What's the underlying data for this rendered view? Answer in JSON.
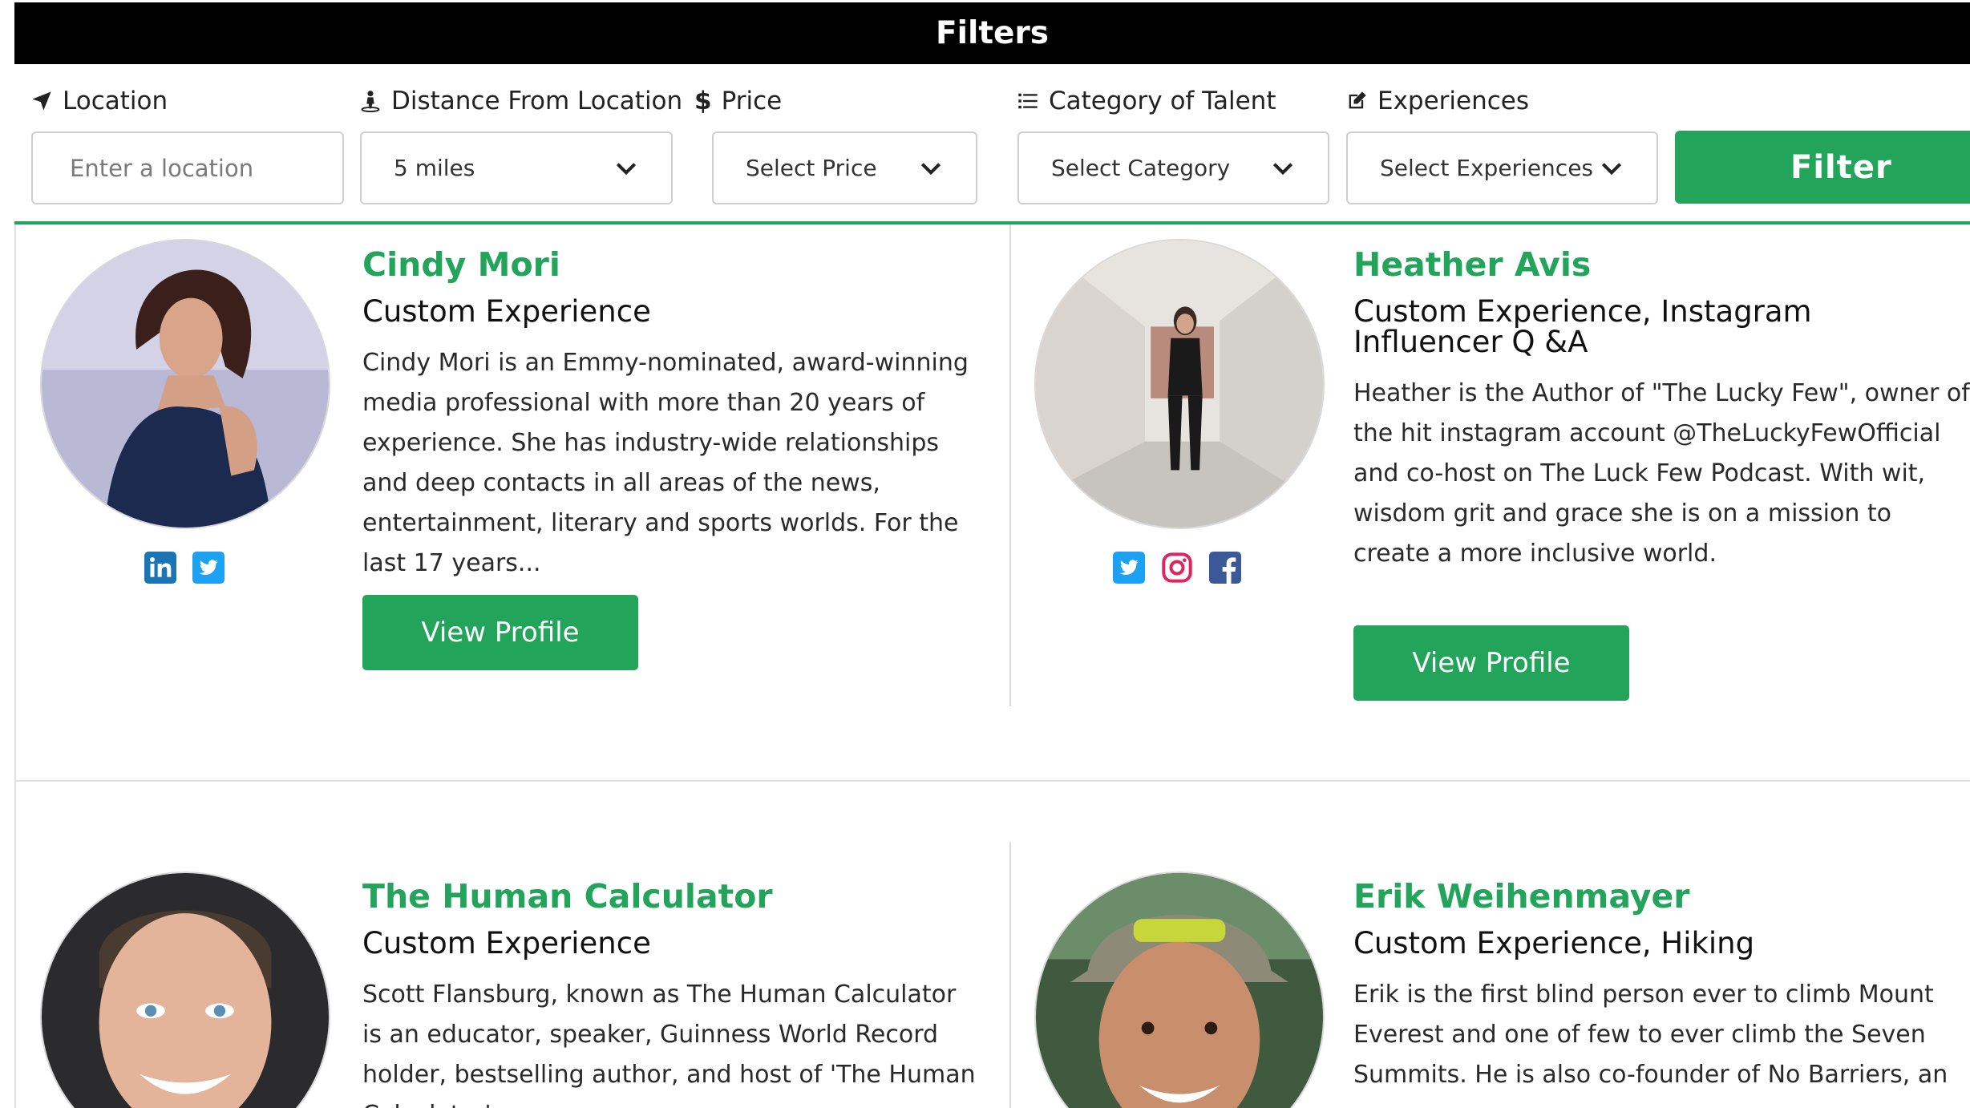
{
  "header": {
    "title": "Filters"
  },
  "filters": {
    "location": {
      "label": "Location",
      "placeholder": "Enter a location"
    },
    "distance": {
      "label": "Distance From Location",
      "value": "5 miles"
    },
    "price": {
      "label": "Price",
      "value": "Select Price"
    },
    "category": {
      "label": "Category of Talent",
      "value": "Select Category"
    },
    "experiences": {
      "label": "Experiences",
      "value": "Select Experiences"
    },
    "filter_button": "Filter"
  },
  "talents": [
    {
      "name": "Cindy Mori",
      "category": "Custom Experience",
      "description": "Cindy Mori is an Emmy-nominated, award-winning media professional with more than 20 years of experience. She has industry-wide relationships and deep contacts in all areas of the news, entertainment, literary and sports worlds. For the last 17 years...",
      "button": "View Profile",
      "social": [
        "linkedin-icon",
        "twitter-icon"
      ]
    },
    {
      "name": "Heather Avis",
      "category": "Custom Experience, Instagram Influencer Q &A",
      "description": "Heather is the Author of \"The Lucky Few\", owner of the hit instagram account @TheLuckyFewOfficial and co-host on The Luck Few Podcast. With wit, wisdom grit and grace she is on a mission to create a more inclusive world.",
      "button": "View Profile",
      "social": [
        "twitter-icon",
        "instagram-icon",
        "facebook-icon"
      ]
    },
    {
      "name": "The Human Calculator",
      "category": "Custom Experience",
      "description": "Scott Flansburg, known as The Human Calculator is an educator, speaker, Guinness World Record holder, bestselling author, and host of 'The Human Calculator'"
    },
    {
      "name": "Erik Weihenmayer",
      "category": "Custom Experience, Hiking",
      "description": "Erik is the first blind person ever to climb Mount Everest and one of few to ever climb the Seven Summits. He is also co-founder of No Barriers, an"
    }
  ],
  "colors": {
    "accent": "#22a55a",
    "header_bg": "#000000"
  }
}
